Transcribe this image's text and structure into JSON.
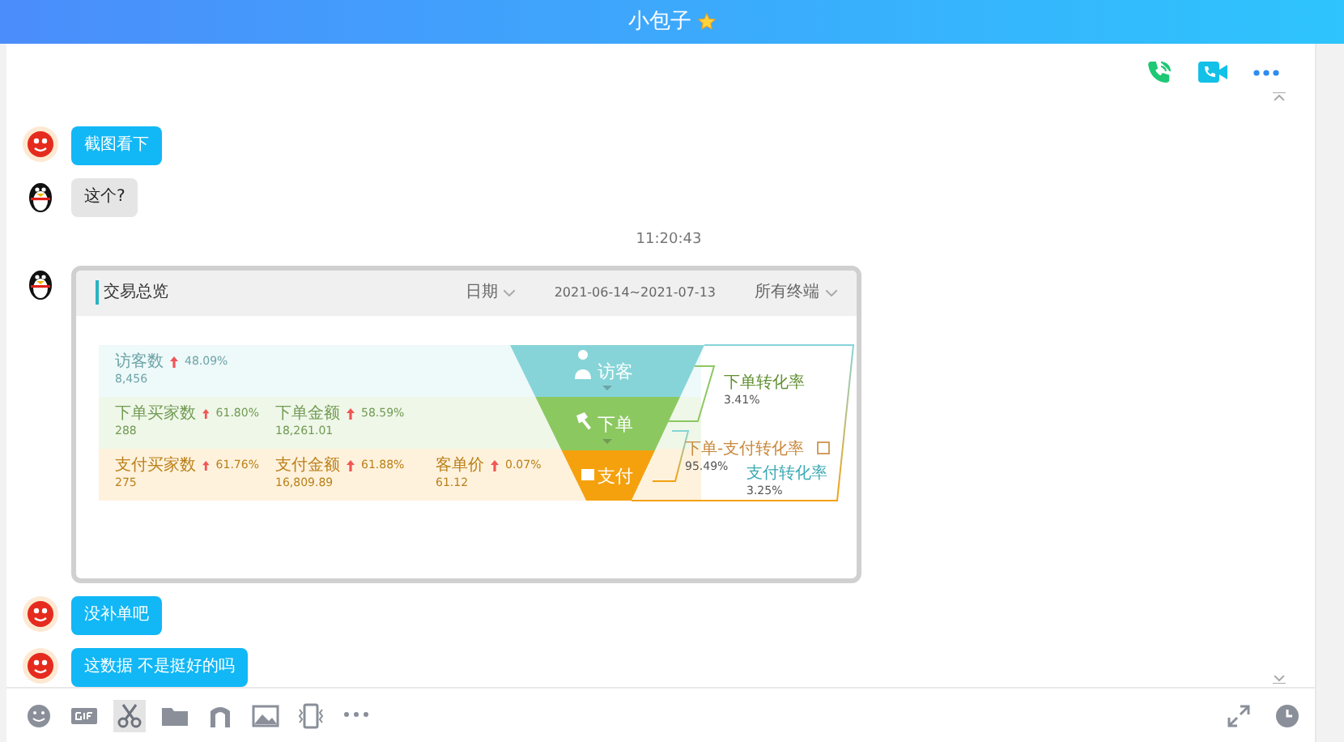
{
  "window": {
    "title": "小包子",
    "starred": true
  },
  "messages": [
    {
      "kind": "friend_text",
      "text": "截图看下"
    },
    {
      "kind": "my_text",
      "text": "这个?"
    },
    {
      "kind": "time",
      "text": "11:20:43"
    },
    {
      "kind": "my_image",
      "screenshot": {
        "title": "交易总览",
        "filters": [
          {
            "label": "日期",
            "dropdown": true
          },
          {
            "label": "2021-06-14~2021-07-13",
            "dropdown": false
          },
          {
            "label": "所有终端",
            "dropdown": true
          }
        ],
        "tiers": [
          {
            "kind": "visitor",
            "stage": "访客",
            "color": "#86d4d8",
            "metrics": [
              {
                "label": "访客数",
                "change": "48.09%",
                "value": "8,456"
              }
            ]
          },
          {
            "kind": "order",
            "stage": "下单",
            "color": "#8cc860",
            "metrics": [
              {
                "label": "下单买家数",
                "change": "61.80%",
                "value": "288"
              },
              {
                "label": "下单金额",
                "change": "58.59%",
                "value": "18,261.01"
              }
            ]
          },
          {
            "kind": "payment",
            "stage": "支付",
            "color": "#f5a10e",
            "metrics": [
              {
                "label": "支付买家数",
                "change": "61.76%",
                "value": "275"
              },
              {
                "label": "支付金额",
                "change": "61.88%",
                "value": "16,809.89"
              },
              {
                "label": "客单价",
                "change": "0.07%",
                "value": "61.12"
              }
            ]
          }
        ],
        "conversions": [
          {
            "label": "下单转化率",
            "value": "3.41%",
            "info": false
          },
          {
            "label": "下单-支付转化率",
            "value": "95.49%",
            "info": true
          },
          {
            "label": "支付转化率",
            "value": "3.25%",
            "info": false
          }
        ]
      }
    },
    {
      "kind": "friend_text",
      "text": "没补单吧"
    },
    {
      "kind": "friend_text",
      "text": "这数据 不是挺好的吗"
    }
  ],
  "toolbar": [
    {
      "kind": "emoji",
      "selected": false
    },
    {
      "kind": "gif",
      "selected": false
    },
    {
      "kind": "scissors",
      "selected": true
    },
    {
      "kind": "folder",
      "selected": false
    },
    {
      "kind": "music",
      "selected": false
    },
    {
      "kind": "image",
      "selected": false
    },
    {
      "kind": "shake",
      "selected": false
    },
    {
      "kind": "more",
      "selected": false
    }
  ]
}
